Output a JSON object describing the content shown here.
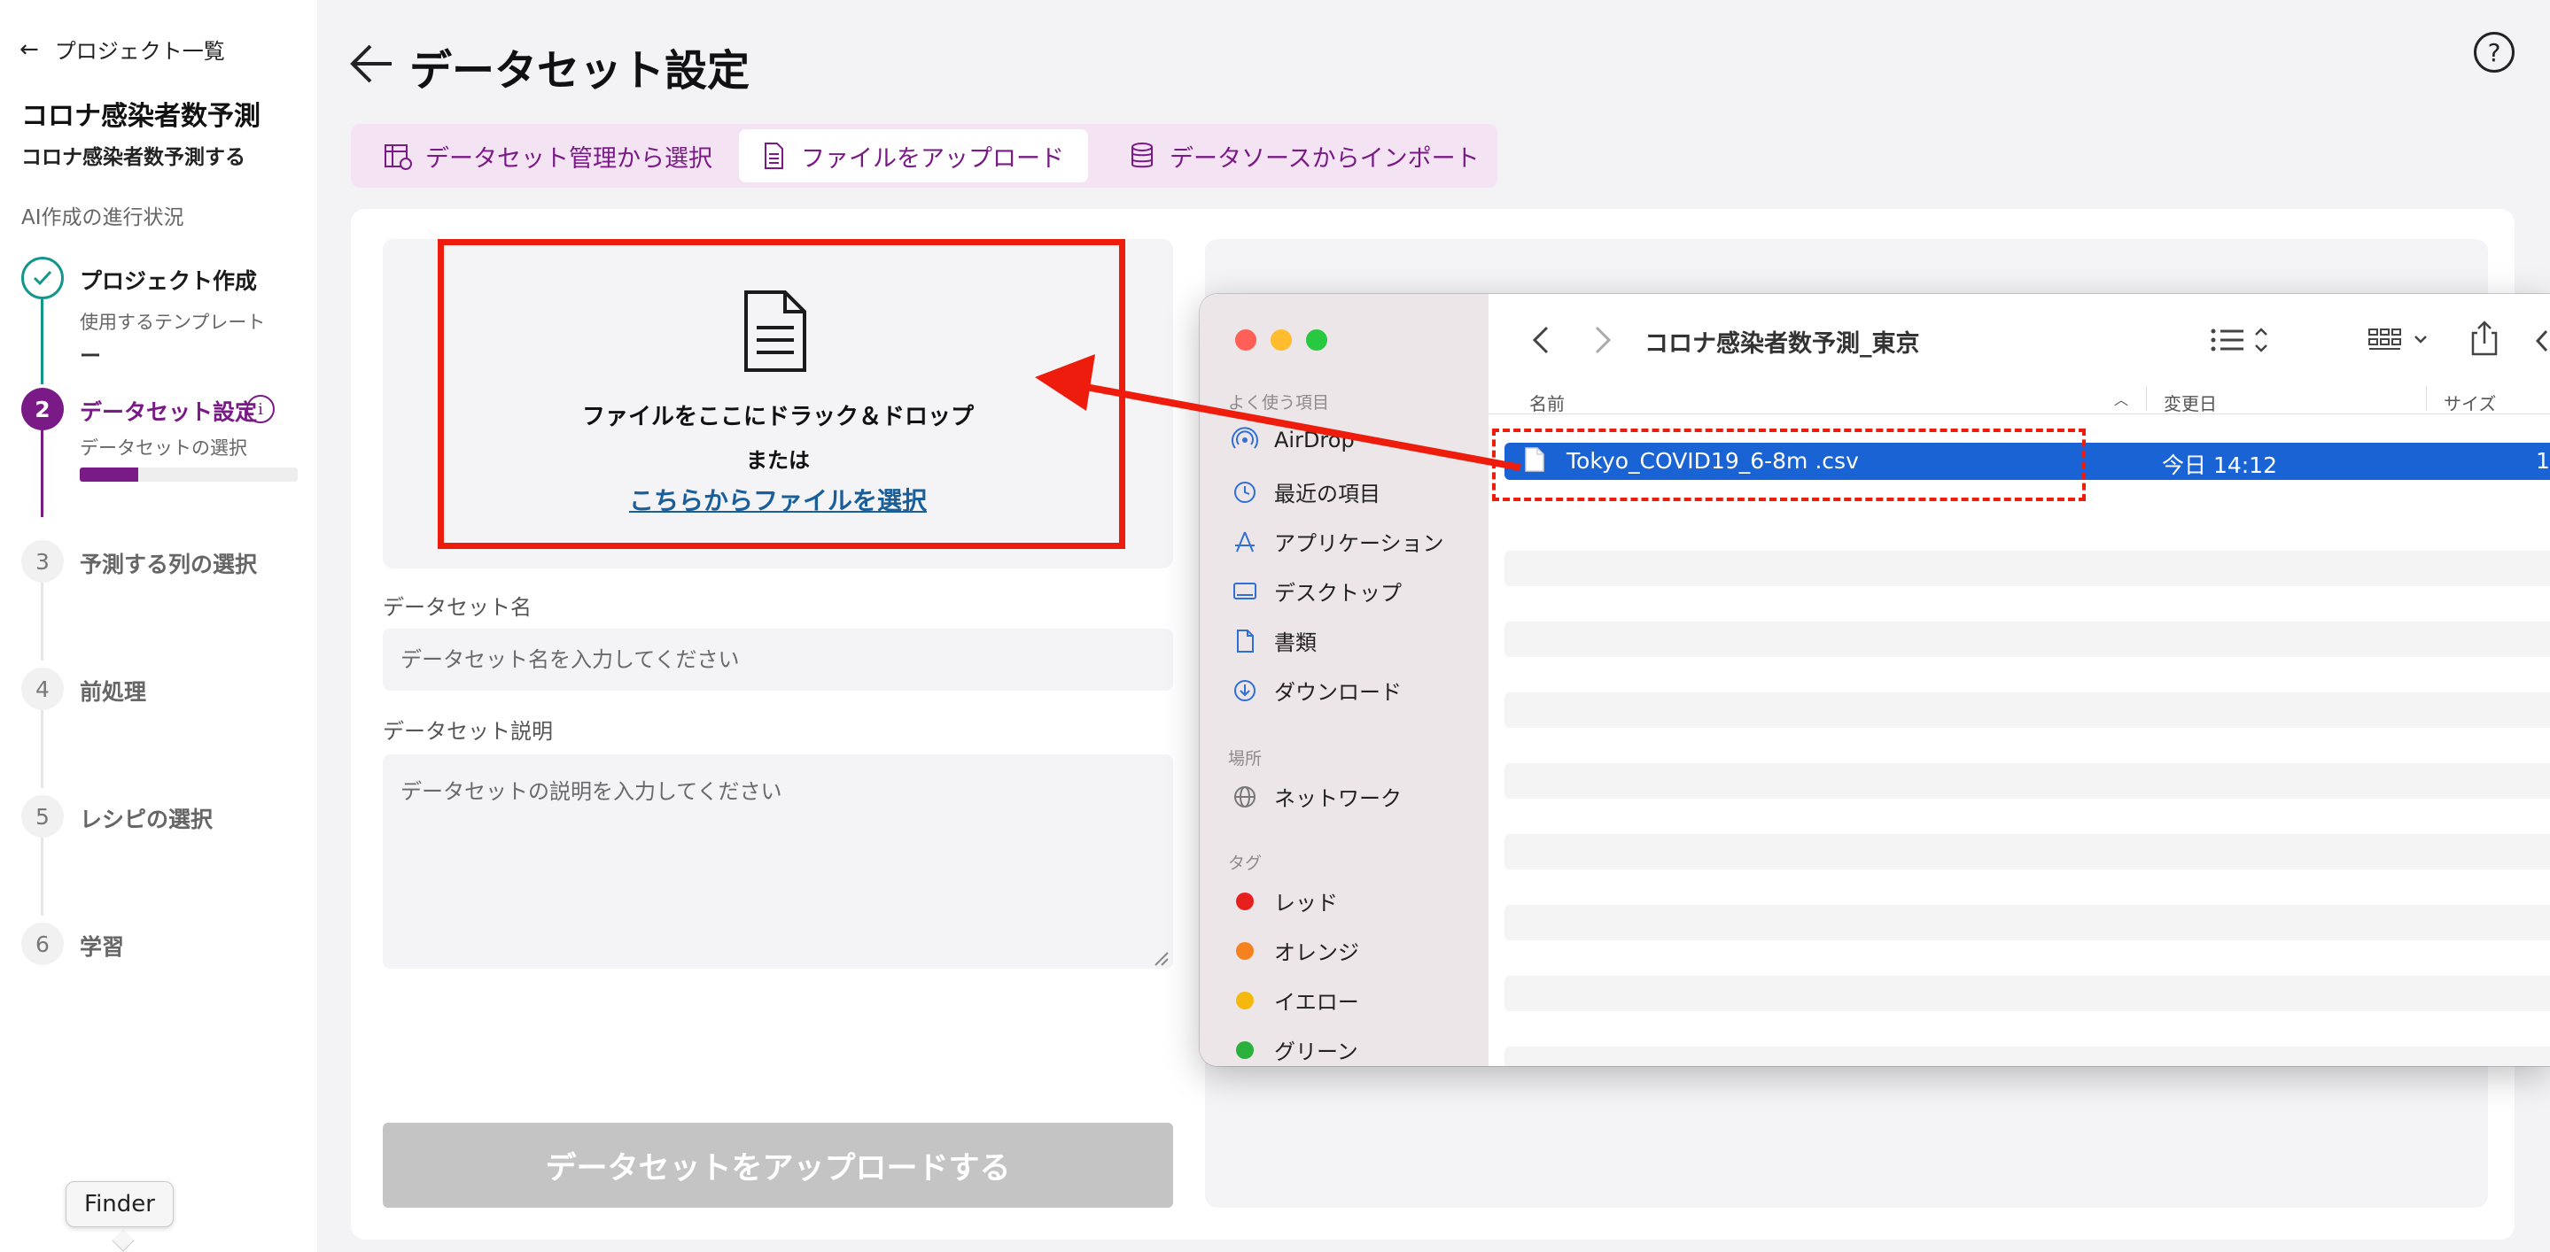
{
  "sidebar": {
    "back_label": "プロジェクト一覧",
    "project_title": "コロナ感染者数予測",
    "project_subtitle": "コロナ感染者数予測する",
    "progress_label": "AI作成の進行状況",
    "steps": [
      {
        "number": "",
        "label": "プロジェクト作成",
        "sub": "使用するテンプレート",
        "sub2": "ー",
        "state": "done"
      },
      {
        "number": "2",
        "label": "データセット設定",
        "sub": "データセットの選択",
        "state": "active",
        "progress": 0.27
      },
      {
        "number": "3",
        "label": "予測する列の選択",
        "state": "todo"
      },
      {
        "number": "4",
        "label": "前処理",
        "state": "todo"
      },
      {
        "number": "5",
        "label": "レシピの選択",
        "state": "todo"
      },
      {
        "number": "6",
        "label": "学習",
        "state": "todo"
      }
    ]
  },
  "header": {
    "title": "データセット設定",
    "help_glyph": "?"
  },
  "tabs": [
    {
      "label": "データセット管理から選択",
      "icon": "table-icon",
      "selected": false
    },
    {
      "label": "ファイルをアップロード",
      "icon": "file-icon",
      "selected": true
    },
    {
      "label": "データソースからインポート",
      "icon": "database-icon",
      "selected": false
    }
  ],
  "dropzone": {
    "main_text": "ファイルをここにドラック＆ドロップ",
    "or_text": "または",
    "link_text": "こちらからファイルを選択"
  },
  "form": {
    "name_label": "データセット名",
    "name_placeholder": "データセット名を入力してください",
    "desc_label": "データセット説明",
    "desc_placeholder": "データセットの説明を入力してください",
    "upload_button": "データセットをアップロードする"
  },
  "finder": {
    "folder_title": "コロナ感染者数予測_東京",
    "section_favorites": "よく使う項目",
    "favorites": [
      {
        "label": "AirDrop",
        "icon": "airdrop-icon"
      },
      {
        "label": "最近の項目",
        "icon": "clock-icon"
      },
      {
        "label": "アプリケーション",
        "icon": "applications-icon"
      },
      {
        "label": "デスクトップ",
        "icon": "desktop-icon"
      },
      {
        "label": "書類",
        "icon": "document-icon"
      },
      {
        "label": "ダウンロード",
        "icon": "download-icon"
      }
    ],
    "section_locations": "場所",
    "locations": [
      {
        "label": "ネットワーク",
        "icon": "network-icon"
      }
    ],
    "section_tags": "タグ",
    "tags": [
      {
        "label": "レッド",
        "color": "#e8201d"
      },
      {
        "label": "オレンジ",
        "color": "#f5821f"
      },
      {
        "label": "イエロー",
        "color": "#f5b80c"
      },
      {
        "label": "グリーン",
        "color": "#2ab13c"
      }
    ],
    "columns": {
      "name": "名前",
      "modified": "変更日",
      "size": "サイズ"
    },
    "file": {
      "name": "Tokyo_COVID19_6-8m .csv",
      "modified": "今日 14:12",
      "size_partial": "1"
    }
  },
  "tooltip": "Finder",
  "colors": {
    "accent": "#7a1a87",
    "done": "#13968c",
    "annotation_red": "#ee1c0c",
    "finder_selection": "#1a63d4"
  }
}
